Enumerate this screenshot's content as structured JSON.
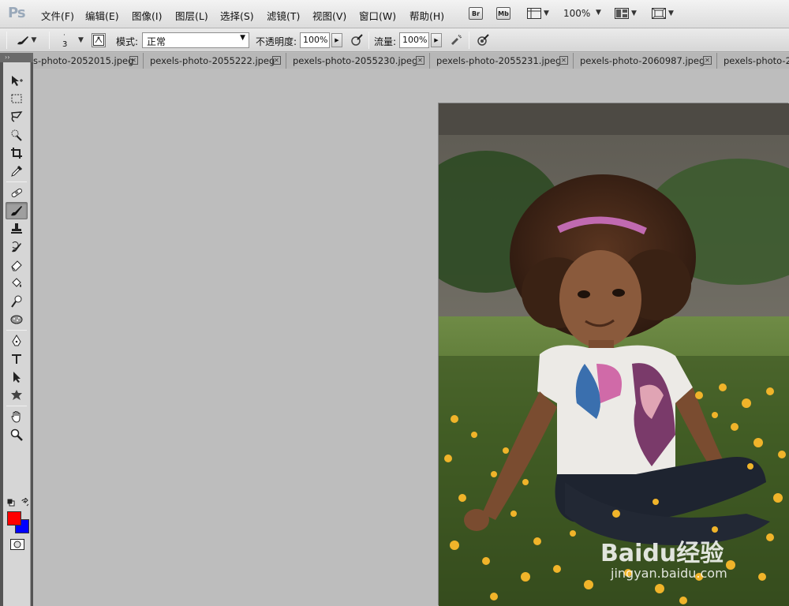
{
  "app": {
    "logo": "Ps"
  },
  "menu": [
    {
      "label": "文件(F)",
      "name": "menu-file"
    },
    {
      "label": "编辑(E)",
      "name": "menu-edit"
    },
    {
      "label": "图像(I)",
      "name": "menu-image"
    },
    {
      "label": "图层(L)",
      "name": "menu-layer"
    },
    {
      "label": "选择(S)",
      "name": "menu-select"
    },
    {
      "label": "滤镜(T)",
      "name": "menu-filter"
    },
    {
      "label": "视图(V)",
      "name": "menu-view"
    },
    {
      "label": "窗口(W)",
      "name": "menu-window"
    },
    {
      "label": "帮助(H)",
      "name": "menu-help"
    }
  ],
  "appbar": {
    "bridge_label": "Br",
    "minibridge_label": "Mb",
    "zoom": "100%"
  },
  "options": {
    "brush_size": "3",
    "mode_label": "模式:",
    "mode_value": "正常",
    "opacity_label": "不透明度:",
    "opacity_value": "100%",
    "flow_label": "流量:",
    "flow_value": "100%"
  },
  "tabs": [
    {
      "label": "s-photo-2052015.jpeg"
    },
    {
      "label": "pexels-photo-2055222.jpeg"
    },
    {
      "label": "pexels-photo-2055230.jpeg"
    },
    {
      "label": "pexels-photo-2055231.jpeg"
    },
    {
      "label": "pexels-photo-2060987.jpeg"
    },
    {
      "label": "pexels-photo-20"
    }
  ],
  "tools": [
    {
      "name": "move-tool-icon"
    },
    {
      "name": "marquee-tool-icon"
    },
    {
      "name": "lasso-tool-icon"
    },
    {
      "name": "quick-select-tool-icon"
    },
    {
      "name": "crop-tool-icon"
    },
    {
      "name": "eyedropper-tool-icon"
    },
    {
      "name": "healing-brush-tool-icon"
    },
    {
      "name": "brush-tool-icon",
      "active": true
    },
    {
      "name": "clone-stamp-tool-icon"
    },
    {
      "name": "history-brush-tool-icon"
    },
    {
      "name": "eraser-tool-icon"
    },
    {
      "name": "paint-bucket-tool-icon"
    },
    {
      "name": "dodge-tool-icon"
    },
    {
      "name": "sponge-tool-icon"
    },
    {
      "name": "pen-tool-icon"
    },
    {
      "name": "type-tool-icon"
    },
    {
      "name": "path-select-tool-icon"
    },
    {
      "name": "custom-shape-tool-icon"
    },
    {
      "name": "hand-tool-icon"
    },
    {
      "name": "zoom-tool-icon"
    }
  ],
  "colors": {
    "foreground": "#ff0000",
    "background": "#0000ff",
    "canvas": "#bdbdbd"
  },
  "watermark": {
    "brand": "Baidu",
    "brand_cn": "经验",
    "url": "jingyan.baidu.com"
  }
}
